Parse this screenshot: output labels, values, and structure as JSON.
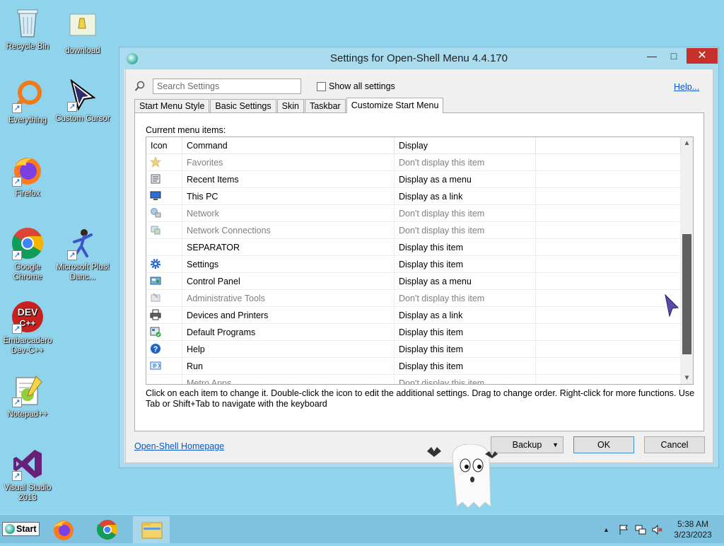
{
  "desktop": {
    "icons": [
      {
        "label": "Recycle Bin"
      },
      {
        "label": "download"
      },
      {
        "label": "Everything"
      },
      {
        "label": "Custom Cursor"
      },
      {
        "label": "Firefox"
      },
      {
        "label": "Google Chrome"
      },
      {
        "label": "Microsoft Plus! Danc..."
      },
      {
        "label": "Embarcadero Dev-C++"
      },
      {
        "label": "Notepad++"
      },
      {
        "label": "Visual Studio 2013"
      }
    ]
  },
  "window": {
    "title": "Settings for Open-Shell Menu 4.4.170",
    "search": {
      "placeholder": "Search Settings",
      "value": ""
    },
    "show_all_label": "Show all settings",
    "help_label": "Help...",
    "tabs": [
      {
        "label": "Start Menu Style"
      },
      {
        "label": "Basic Settings"
      },
      {
        "label": "Skin"
      },
      {
        "label": "Taskbar"
      },
      {
        "label": "Customize Start Menu"
      }
    ],
    "current_items_label": "Current menu items:",
    "columns": {
      "icon": "Icon",
      "command": "Command",
      "display": "Display"
    },
    "rows": [
      {
        "command": "Favorites",
        "display": "Don't display this item",
        "icon": "star-icon"
      },
      {
        "command": "Recent Items",
        "display": "Display as a menu",
        "icon": "recent-items-icon"
      },
      {
        "command": "This PC",
        "display": "Display as a link",
        "icon": "computer-icon"
      },
      {
        "command": "Network",
        "display": "Don't display this item",
        "icon": "network-icon"
      },
      {
        "command": "Network Connections",
        "display": "Don't display this item",
        "icon": "network-connections-icon"
      },
      {
        "command": "SEPARATOR",
        "display": "Display this item",
        "icon": ""
      },
      {
        "command": "Settings",
        "display": "Display this item",
        "icon": "gear-icon"
      },
      {
        "command": "Control Panel",
        "display": "Display as a menu",
        "icon": "control-panel-icon"
      },
      {
        "command": "Administrative Tools",
        "display": "Don't display this item",
        "icon": "admin-tools-icon"
      },
      {
        "command": "Devices and Printers",
        "display": "Display as a link",
        "icon": "printer-icon"
      },
      {
        "command": "Default Programs",
        "display": "Display this item",
        "icon": "default-programs-icon"
      },
      {
        "command": "Help",
        "display": "Display this item",
        "icon": "help-icon"
      },
      {
        "command": "Run",
        "display": "Display this item",
        "icon": "run-icon"
      },
      {
        "command": "Metro Apps",
        "display": "Don't display this item",
        "icon": ""
      }
    ],
    "hint": "Click on each item to change it. Double-click the icon to edit the additional settings. Drag to change order. Right-click for more functions. Use Tab or Shift+Tab to navigate with the keyboard",
    "homepage_label": "Open-Shell Homepage",
    "buttons": {
      "backup": "Backup",
      "ok": "OK",
      "cancel": "Cancel"
    }
  },
  "taskbar": {
    "start_label": "Start",
    "clock_time": "5:38 AM",
    "clock_date": "3/23/2023"
  },
  "colors": {
    "accent": "#0b55c4",
    "close": "#c7312b",
    "desktop": "#8fd3ec"
  }
}
